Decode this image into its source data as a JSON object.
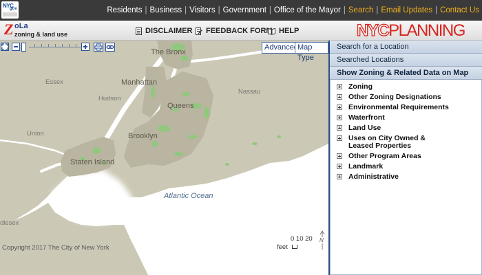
{
  "top_nav": {
    "logo_text": "NYC",
    "logo_sub": "gov",
    "links": [
      {
        "label": "Residents",
        "color": "#ffffff"
      },
      {
        "label": "Business",
        "color": "#ffffff"
      },
      {
        "label": "Visitors",
        "color": "#ffffff"
      },
      {
        "label": "Government",
        "color": "#ffffff"
      },
      {
        "label": "Office of the Mayor",
        "color": "#ffffff"
      },
      {
        "label": "Search",
        "color": "#f0b020"
      },
      {
        "label": "Email Updates",
        "color": "#f0b020"
      },
      {
        "label": "Contact Us",
        "color": "#f0b020"
      }
    ]
  },
  "header": {
    "logo_z": "Z",
    "logo_la": "oLa",
    "logo_sub": "zoning & land use",
    "disclaimer": "DISCLAIMER",
    "feedback": "FEEDBACK FORM",
    "help": "HELP",
    "brand_nyc": "NYC",
    "brand_planning": "PLANNING",
    "brand_color": "#d8261f"
  },
  "map": {
    "buttons": {
      "advanced": "Advanced",
      "map_type": "Map Type"
    },
    "labels": {
      "bronx": "The Bronx",
      "manhattan": "Manhattan",
      "queens": "Queens",
      "brooklyn": "Brooklyn",
      "staten_island": "Staten Island",
      "essex": "Essex",
      "hudson": "Hudson",
      "nassau": "Nassau",
      "union": "Union",
      "middlesex": "dlesex",
      "ocean": "Atlantic Ocean"
    },
    "copyright": "Copyright 2017 The City of New York",
    "scale": {
      "ticks": "0 10 20",
      "unit": "feet"
    },
    "north": "N",
    "land_color": "#c5c2ae",
    "park_color": "#92c77f",
    "water_color": "#ffffff"
  },
  "sidebar": {
    "sections": [
      {
        "label": "Search for a Location",
        "active": false
      },
      {
        "label": "Searched Locations",
        "active": false
      },
      {
        "label": "Show Zoning & Related Data on Map",
        "active": true
      }
    ],
    "items": [
      "Zoning",
      "Other Zoning Designations",
      "Environmental Requirements",
      "Waterfront",
      "Land Use",
      "Uses on City Owned & Leased Properties",
      "Other Program Areas",
      "Landmark",
      "Administrative"
    ]
  }
}
